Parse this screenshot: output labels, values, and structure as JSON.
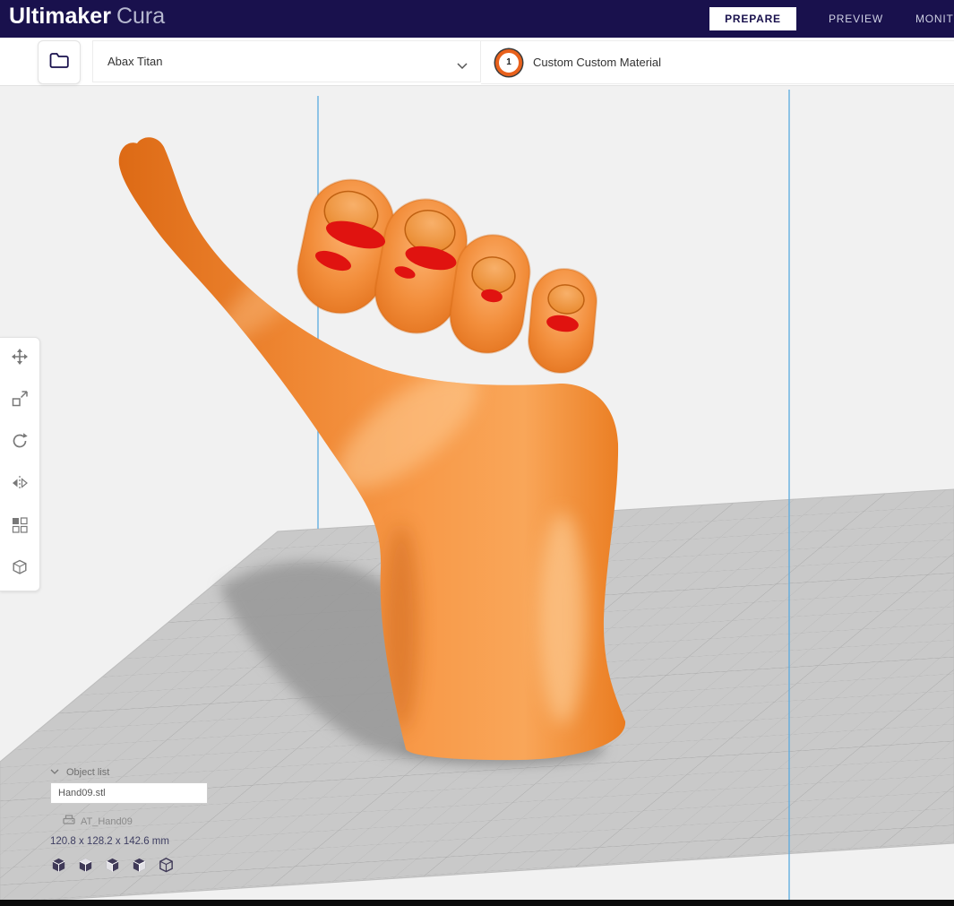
{
  "header": {
    "brand_bold": "Ultimaker",
    "brand_light": "Cura",
    "stages": [
      {
        "label": "PREPARE",
        "active": true
      },
      {
        "label": "PREVIEW",
        "active": false
      },
      {
        "label": "MONITOR",
        "active": false
      }
    ]
  },
  "toolbar": {
    "printer_name": "Abax Titan",
    "extruder_number": "1",
    "material_label": "Custom Custom Material"
  },
  "left_toolbar": {
    "tools": [
      "move",
      "scale",
      "rotate",
      "mirror",
      "per-model-settings",
      "support-blocker"
    ]
  },
  "object_panel": {
    "title": "Object list",
    "file_name": "Hand09.stl",
    "printer_label": "AT_Hand09",
    "dimensions": "120.8 x 128.2 x 142.6 mm"
  },
  "scene": {
    "model_name": "Hand09.stl",
    "model_color": "#ef8030",
    "overhang_color": "#e01310",
    "plate_color": "#c9c9c9",
    "grid_line_color": "#b3b3b3",
    "build_volume_line_color": "#58aadf",
    "background_color": "#f1f1f1"
  }
}
